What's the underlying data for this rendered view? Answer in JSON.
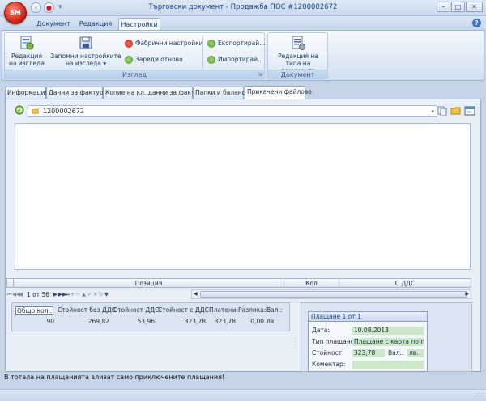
{
  "window": {
    "title": "Търговски документ - Продажба ПОС #1200002672",
    "app_orb_label": "SM",
    "minimize": "–",
    "maximize": "□",
    "close": "✕"
  },
  "ribbon_tabs": [
    {
      "label": "Документ"
    },
    {
      "label": "Редакция"
    },
    {
      "label": "Настройки"
    }
  ],
  "ribbon": {
    "edit_view_label": "Редакция на изгледа",
    "save_settings_label": "Запомни настройките на изгледа",
    "factory_settings_label": "Фабрични настройки",
    "reload_label": "Зареди отново",
    "export_label": "Експортирай...",
    "import_label": "Импортирай...",
    "group_view_caption": "Изглед",
    "edit_doc_type_label": "Редакция на типа на документа",
    "group_document_caption": "Документ"
  },
  "doc_tabs": [
    {
      "label": "Информация"
    },
    {
      "label": "Данни за фактура"
    },
    {
      "label": "Копие на кл. данни за фактура"
    },
    {
      "label": "Папки и баланси"
    },
    {
      "label": "Прикачени файлове"
    }
  ],
  "attachments": {
    "path": "1200002672"
  },
  "grid": {
    "columns": [
      "Позиция",
      "Кол",
      "С ДДС"
    ],
    "record_info": "1 от 56"
  },
  "totals": {
    "headers": [
      "Общо кол.:",
      "Стойност без ДДС:",
      "Стойност ДДС:",
      "Стойност с ДДС:",
      "Платени:",
      "Разлика:",
      "Вал.:"
    ],
    "values": [
      "90",
      "269,82",
      "53,96",
      "323,78",
      "323,78",
      "0,00",
      "лв."
    ]
  },
  "payment": {
    "title": "Плащане 1 от 1",
    "date_label": "Дата:",
    "date_value": "10.08.2013",
    "type_label": "Тип плащане:",
    "type_value": "Плащане с карта по прод",
    "amount_label": "Стойност:",
    "amount_value": "323,78",
    "currency_label": "Вал.:",
    "currency_value": "лв.",
    "comment_label": "Коментар:",
    "comment_value": ""
  },
  "footer_note": "В тотала на плащанията влизат само приключените плащания!",
  "colors": {
    "accent": "#15428b",
    "background": "#c4d3e6",
    "field_green": "#cbe8c8",
    "orb_red": "#d3281b"
  }
}
